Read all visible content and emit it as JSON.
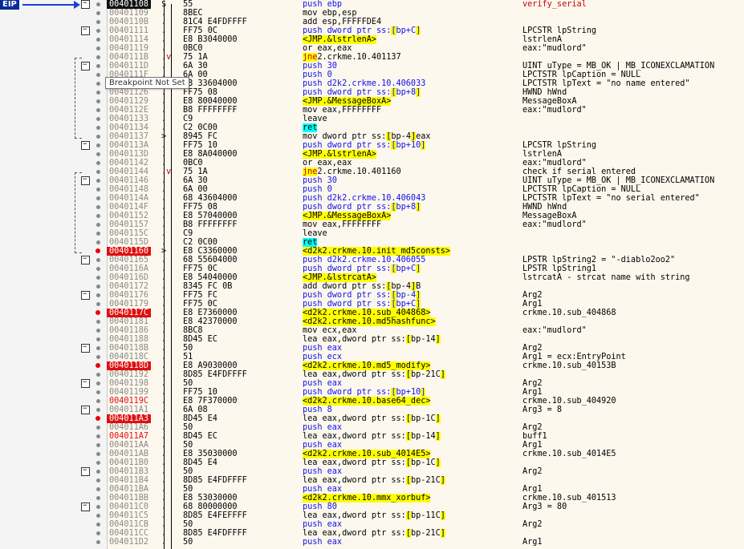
{
  "eip_label": "EIP",
  "tooltip": "Breakpoint Not Set",
  "rows": [
    {
      "addr": "00401108",
      "state": "cur",
      "mark": "$",
      "bytes": "55",
      "instr": "push ebp",
      "cmt": "verify_serial",
      "cmtfn": true,
      "box": true
    },
    {
      "addr": "00401109",
      "mark": ".",
      "bytes": "8BEC",
      "instr": "mov ebp,esp",
      "cmt": ""
    },
    {
      "addr": "0040110B",
      "mark": ".",
      "bytes": "81C4 E4FDFFFF",
      "instr": "add esp,FFFFFDE4",
      "cmt": ""
    },
    {
      "addr": "00401111",
      "mark": ".",
      "bytes": "FF75 0C",
      "instr": "push dword ptr ss:[ebp+C]",
      "cmt": "LPCSTR lpString",
      "box": true
    },
    {
      "addr": "00401114",
      "mark": ".",
      "bytes": "E8 B3040000",
      "instr": "call <JMP.&lstrlenA>",
      "cmt": "lstrlenA"
    },
    {
      "addr": "00401119",
      "mark": ".",
      "bytes": "0BC0",
      "instr": "or eax,eax",
      "cmt": "eax:\"mudlord\""
    },
    {
      "addr": "0040111B",
      "mark": ".v",
      "bytes": "75 1A",
      "instr": "jne d2k2.crkme.10.401137",
      "cmt": ""
    },
    {
      "addr": "0040111D",
      "mark": ".",
      "bytes": "6A 30",
      "instr": "push 30",
      "cmt": "UINT uType = MB_OK | MB_ICONEXCLAMATION",
      "box": true
    },
    {
      "addr": "0040111F",
      "mark": ".",
      "bytes": "6A 00",
      "instr": "push 0",
      "cmt": "LPCTSTR lpCaption = NULL"
    },
    {
      "addr": "00401121",
      "mark": ".",
      "bytes": "68 33604000",
      "instr": "push d2k2.crkme.10.406033",
      "cmt": "LPCTSTR lpText = \"no name entered\""
    },
    {
      "addr": "00401126",
      "mark": ".",
      "bytes": "FF75 08",
      "instr": "push dword ptr ss:[ebp+8]",
      "cmt": "HWND hWnd"
    },
    {
      "addr": "00401129",
      "mark": ".",
      "bytes": "E8 80040000",
      "instr": "call <JMP.&MessageBoxA>",
      "cmt": "MessageBoxA"
    },
    {
      "addr": "0040112E",
      "mark": ".",
      "bytes": "B8 FFFFFFFF",
      "instr": "mov eax,FFFFFFFF",
      "cmt": "eax:\"mudlord\""
    },
    {
      "addr": "00401133",
      "mark": ".",
      "bytes": "C9",
      "instr": "leave",
      "cmt": ""
    },
    {
      "addr": "00401134",
      "mark": ".",
      "bytes": "C2 0C00",
      "instr": "ret C",
      "cmt": ""
    },
    {
      "addr": "00401137",
      "mark": ">",
      "bytes": "8945 FC",
      "instr": "mov dword ptr ss:[ebp-4],eax",
      "cmt": ""
    },
    {
      "addr": "0040113A",
      "mark": ".",
      "bytes": "FF75 10",
      "instr": "push dword ptr ss:[ebp+10]",
      "cmt": "LPCSTR lpString",
      "box": true
    },
    {
      "addr": "0040113D",
      "mark": ".",
      "bytes": "E8 8A040000",
      "instr": "call <JMP.&lstrlenA>",
      "cmt": "lstrlenA"
    },
    {
      "addr": "00401142",
      "mark": ".",
      "bytes": "0BC0",
      "instr": "or eax,eax",
      "cmt": "eax:\"mudlord\""
    },
    {
      "addr": "00401144",
      "mark": ".v",
      "bytes": "75 1A",
      "instr": "jne d2k2.crkme.10.401160",
      "cmt": "check if serial entered"
    },
    {
      "addr": "00401146",
      "mark": ".",
      "bytes": "6A 30",
      "instr": "push 30",
      "cmt": "UINT uType = MB_OK | MB_ICONEXCLAMATION",
      "box": true
    },
    {
      "addr": "00401148",
      "mark": ".",
      "bytes": "6A 00",
      "instr": "push 0",
      "cmt": "LPCTSTR lpCaption = NULL"
    },
    {
      "addr": "0040114A",
      "mark": ".",
      "bytes": "68 43604000",
      "instr": "push d2k2.crkme.10.406043",
      "cmt": "LPCTSTR lpText = \"no serial entered\""
    },
    {
      "addr": "0040114F",
      "mark": ".",
      "bytes": "FF75 08",
      "instr": "push dword ptr ss:[ebp+8]",
      "cmt": "HWND hWnd"
    },
    {
      "addr": "00401152",
      "mark": ".",
      "bytes": "E8 57040000",
      "instr": "call <JMP.&MessageBoxA>",
      "cmt": "MessageBoxA"
    },
    {
      "addr": "00401157",
      "mark": ".",
      "bytes": "B8 FFFFFFFF",
      "instr": "mov eax,FFFFFFFF",
      "cmt": "eax:\"mudlord\""
    },
    {
      "addr": "0040115C",
      "mark": ".",
      "bytes": "C9",
      "instr": "leave",
      "cmt": ""
    },
    {
      "addr": "0040115D",
      "mark": ".",
      "bytes": "C2 0C00",
      "instr": "ret C",
      "cmt": ""
    },
    {
      "addr": "00401160",
      "state": "bp",
      "mark": ">",
      "bytes": "E8 C3360000",
      "instr": "call <d2k2.crkme.10.init_md5consts>",
      "cmt": ""
    },
    {
      "addr": "00401165",
      "mark": ".",
      "bytes": "68 55604000",
      "instr": "push d2k2.crkme.10.406055",
      "cmt": "LPSTR lpString2 = \"-diablo2oo2\"",
      "box": true
    },
    {
      "addr": "0040116A",
      "mark": ".",
      "bytes": "FF75 0C",
      "instr": "push dword ptr ss:[ebp+C]",
      "cmt": "LPSTR lpString1"
    },
    {
      "addr": "0040116D",
      "mark": ".",
      "bytes": "E8 54040000",
      "instr": "call <JMP.&lstrcatA>",
      "cmt": "lstrcatA - strcat name with string"
    },
    {
      "addr": "00401172",
      "mark": ".",
      "bytes": "8345 FC 0B",
      "instr": "add dword ptr ss:[ebp-4],B",
      "cmt": ""
    },
    {
      "addr": "00401176",
      "mark": ".",
      "bytes": "FF75 FC",
      "instr": "push dword ptr ss:[ebp-4]",
      "cmt": "Arg2",
      "box": true
    },
    {
      "addr": "00401179",
      "mark": ".",
      "bytes": "FF75 0C",
      "instr": "push dword ptr ss:[ebp+C]",
      "cmt": "Arg1"
    },
    {
      "addr": "0040117C",
      "state": "bp",
      "mark": ".",
      "bytes": "E8 E7360000",
      "instr": "call <d2k2.crkme.10.sub_404868>",
      "cmt": "crkme.10.sub_404868"
    },
    {
      "addr": "00401181",
      "mark": ".",
      "bytes": "E8 42370000",
      "instr": "call <d2k2.crkme.10.md5hashfunc>",
      "cmt": ""
    },
    {
      "addr": "00401186",
      "mark": ".",
      "bytes": "8BC8",
      "instr": "mov ecx,eax",
      "cmt": "eax:\"mudlord\""
    },
    {
      "addr": "00401188",
      "mark": ".",
      "bytes": "8D45 EC",
      "instr": "lea eax,dword ptr ss:[ebp-14]",
      "cmt": ""
    },
    {
      "addr": "0040118B",
      "mark": ".",
      "bytes": "50",
      "instr": "push eax",
      "cmt": "Arg2",
      "box": true
    },
    {
      "addr": "0040118C",
      "mark": ".",
      "bytes": "51",
      "instr": "push ecx",
      "cmt": "Arg1 = ecx:EntryPoint"
    },
    {
      "addr": "0040118D",
      "state": "bp",
      "mark": ".",
      "bytes": "E8 A9030000",
      "instr": "call <d2k2.crkme.10.md5_modify>",
      "cmt": "crkme.10.sub_40153B"
    },
    {
      "addr": "00401192",
      "mark": ".",
      "bytes": "8D85 E4FDFFFF",
      "instr": "lea eax,dword ptr ss:[ebp-21C]",
      "cmt": ""
    },
    {
      "addr": "00401198",
      "mark": ".",
      "bytes": "50",
      "instr": "push eax",
      "cmt": "Arg2",
      "box": true
    },
    {
      "addr": "00401199",
      "mark": ".",
      "bytes": "FF75 10",
      "instr": "push dword ptr ss:[ebp+10]",
      "cmt": "Arg1"
    },
    {
      "addr": "0040119C",
      "state": "bpn",
      "mark": ".",
      "bytes": "E8 7F370000",
      "instr": "call <d2k2.crkme.10.base64_dec>",
      "cmt": "crkme.10.sub_404920"
    },
    {
      "addr": "004011A1",
      "mark": ".",
      "bytes": "6A 08",
      "instr": "push 8",
      "cmt": "Arg3 = 8",
      "box": true
    },
    {
      "addr": "004011A3",
      "state": "bp",
      "mark": ".",
      "bytes": "8D45 E4",
      "instr": "lea eax,dword ptr ss:[ebp-1C]",
      "cmt": ""
    },
    {
      "addr": "004011A6",
      "mark": ".",
      "bytes": "50",
      "instr": "push eax",
      "cmt": "Arg2"
    },
    {
      "addr": "004011A7",
      "state": "bpn",
      "mark": ".",
      "bytes": "8D45 EC",
      "instr": "lea eax,dword ptr ss:[ebp-14]",
      "cmt": "buff1"
    },
    {
      "addr": "004011AA",
      "mark": ".",
      "bytes": "50",
      "instr": "push eax",
      "cmt": "Arg1"
    },
    {
      "addr": "004011AB",
      "mark": ".",
      "bytes": "E8 35030000",
      "instr": "call <d2k2.crkme.10.sub_4014E5>",
      "cmt": "crkme.10.sub_4014E5"
    },
    {
      "addr": "004011B0",
      "mark": ".",
      "bytes": "8D45 E4",
      "instr": "lea eax,dword ptr ss:[ebp-1C]",
      "cmt": ""
    },
    {
      "addr": "004011B3",
      "mark": ".",
      "bytes": "50",
      "instr": "push eax",
      "cmt": "Arg2",
      "box": true
    },
    {
      "addr": "004011B4",
      "mark": ".",
      "bytes": "8D85 E4FDFFFF",
      "instr": "lea eax,dword ptr ss:[ebp-21C]",
      "cmt": ""
    },
    {
      "addr": "004011BA",
      "mark": ".",
      "bytes": "50",
      "instr": "push eax",
      "cmt": "Arg1"
    },
    {
      "addr": "004011BB",
      "mark": ".",
      "bytes": "E8 53030000",
      "instr": "call <d2k2.crkme.10.mmx_xorbuf>",
      "cmt": "crkme.10.sub_401513"
    },
    {
      "addr": "004011C0",
      "mark": ".",
      "bytes": "68 80000000",
      "instr": "push 80",
      "cmt": "Arg3 = 80",
      "box": true
    },
    {
      "addr": "004011C5",
      "mark": ".",
      "bytes": "8D85 E4FEFFFF",
      "instr": "lea eax,dword ptr ss:[ebp-11C]",
      "cmt": ""
    },
    {
      "addr": "004011CB",
      "mark": ".",
      "bytes": "50",
      "instr": "push eax",
      "cmt": "Arg2"
    },
    {
      "addr": "004011CC",
      "mark": ".",
      "bytes": "8D85 E4FDFFFF",
      "instr": "lea eax,dword ptr ss:[ebp-21C]",
      "cmt": ""
    },
    {
      "addr": "004011D2",
      "mark": ".",
      "bytes": "50",
      "instr": "push eax",
      "cmt": "Arg1"
    }
  ]
}
